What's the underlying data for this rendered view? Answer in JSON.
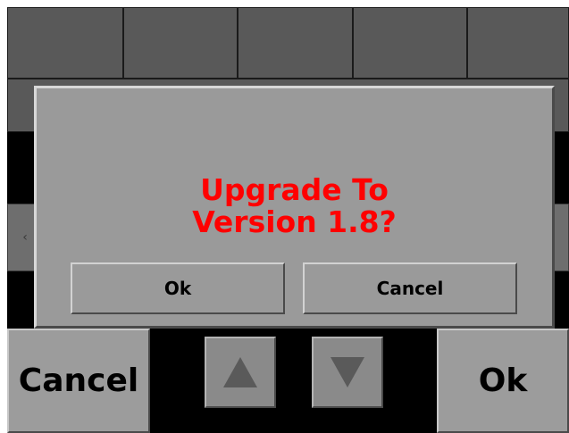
{
  "dialog": {
    "message_line1": "Upgrade To",
    "message_line2": "Version 1.8?",
    "ok_label": "Ok",
    "cancel_label": "Cancel"
  },
  "bottom_bar": {
    "cancel_label": "Cancel",
    "ok_label": "Ok",
    "up_icon": "arrow-up-icon",
    "down_icon": "arrow-down-icon"
  },
  "side_arrows": {
    "left": "‹",
    "right": "›"
  },
  "colors": {
    "message": "#ff0000",
    "dialog_bg": "#9a9a9a",
    "screen_bg": "#000000"
  }
}
